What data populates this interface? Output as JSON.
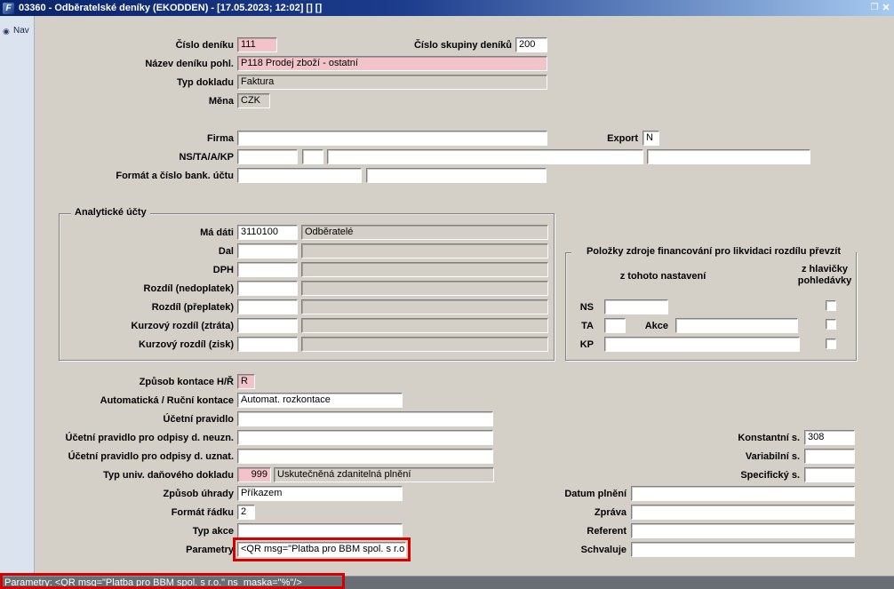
{
  "titlebar": {
    "title": "03360 - Odběratelské deníky (EKODDEN) - [17.05.2023; 12:02]  []  []",
    "app_icon_glyph": "F",
    "restore_glyph": "❐",
    "close_glyph": "✕"
  },
  "sidebar": {
    "nav_label": "Nav",
    "nav_icon_glyph": "◉"
  },
  "form": {
    "cislo_deniku": {
      "label": "Číslo deníku",
      "value": "111"
    },
    "cislo_skupiny_deniku": {
      "label": "Číslo skupiny deníků",
      "value": "200"
    },
    "nazev_deniku_pohl": {
      "label": "Název deníku pohl.",
      "value": "P118 Prodej zboží - ostatní"
    },
    "typ_dokladu": {
      "label": "Typ dokladu",
      "value": "Faktura"
    },
    "mena": {
      "label": "Měna",
      "value": "CZK"
    },
    "firma": {
      "label": "Firma",
      "value": ""
    },
    "export": {
      "label": "Export",
      "value": "N"
    },
    "ns_ta_a_kp": {
      "label": "NS/TA/A/KP",
      "value1": "",
      "value2": "",
      "value3": "",
      "value4": ""
    },
    "format_cislo_bank_uctu": {
      "label": "Formát a číslo bank. účtu",
      "value1": "",
      "value2": ""
    }
  },
  "analyticke_ucty": {
    "title": "Analytické účty",
    "rows": [
      {
        "label": "Má dáti",
        "account": "3110100",
        "name": "Odběratelé"
      },
      {
        "label": "Dal",
        "account": "",
        "name": ""
      },
      {
        "label": "DPH",
        "account": "",
        "name": ""
      },
      {
        "label": "Rozdíl (nedoplatek)",
        "account": "",
        "name": ""
      },
      {
        "label": "Rozdíl (přeplatek)",
        "account": "",
        "name": ""
      },
      {
        "label": "Kurzový rozdíl (ztráta)",
        "account": "",
        "name": ""
      },
      {
        "label": "Kurzový rozdíl (zisk)",
        "account": "",
        "name": ""
      }
    ]
  },
  "polozky_zdroje": {
    "title": "Položky zdroje financování pro likvidaci rozdílu převzít",
    "col_nastaveni": "z tohoto nastavení",
    "col_hlavicky_line1": "z hlavičky",
    "col_hlavicky_line2": "pohledávky",
    "ns": {
      "label": "NS",
      "value": ""
    },
    "ta": {
      "label": "TA",
      "value": ""
    },
    "akce": {
      "label": "Akce",
      "value": ""
    },
    "kp": {
      "label": "KP",
      "value": ""
    }
  },
  "dolni": {
    "zpusob_kontace": {
      "label": "Způsob kontace H/Ř",
      "value": "R"
    },
    "kontace": {
      "label": "Automatická / Ruční kontace",
      "value": "Automat. rozkontace"
    },
    "ucetni_pravidlo": {
      "label": "Účetní pravidlo",
      "value": ""
    },
    "ucetni_pravidlo_neuzn": {
      "label": "Účetní pravidlo pro odpisy d. neuzn.",
      "value": ""
    },
    "ucetni_pravidlo_uznat": {
      "label": "Účetní pravidlo pro odpisy d. uznat.",
      "value": ""
    },
    "typ_univ_dokladu": {
      "label": "Typ univ. daňového dokladu",
      "code": "999",
      "name": "Uskutečněná zdanitelná plnění"
    },
    "zpusob_uhrady": {
      "label": "Způsob úhrady",
      "value": "Příkazem"
    },
    "format_radku": {
      "label": "Formát řádku",
      "value": "2"
    },
    "typ_akce": {
      "label": "Typ akce",
      "value": ""
    },
    "parametry": {
      "label": "Parametry",
      "value": "<QR msg=\"Platba pro BBM spol. s r.o.\""
    },
    "konstantni_s": {
      "label": "Konstantní s.",
      "value": "308"
    },
    "variabilni_s": {
      "label": "Variabilní s.",
      "value": ""
    },
    "specificky_s": {
      "label": "Specifický s.",
      "value": ""
    },
    "datum_plneni": {
      "label": "Datum plnění",
      "value": ""
    },
    "zprava": {
      "label": "Zpráva",
      "value": ""
    },
    "referent": {
      "label": "Referent",
      "value": ""
    },
    "schvaluje": {
      "label": "Schvaluje",
      "value": ""
    }
  },
  "statusbar": {
    "text": "Parametry: <QR msg=\"Platba pro BBM spol. s r.o.\" ns_maska=\"%\"/>"
  },
  "colors": {
    "background": "#d4d0c8",
    "titlebar_start": "#0a246a",
    "titlebar_end": "#a6caf0",
    "field_pink": "#f2c4c9",
    "statusbar_bg": "#686e74",
    "annotation_red": "#d50000"
  }
}
